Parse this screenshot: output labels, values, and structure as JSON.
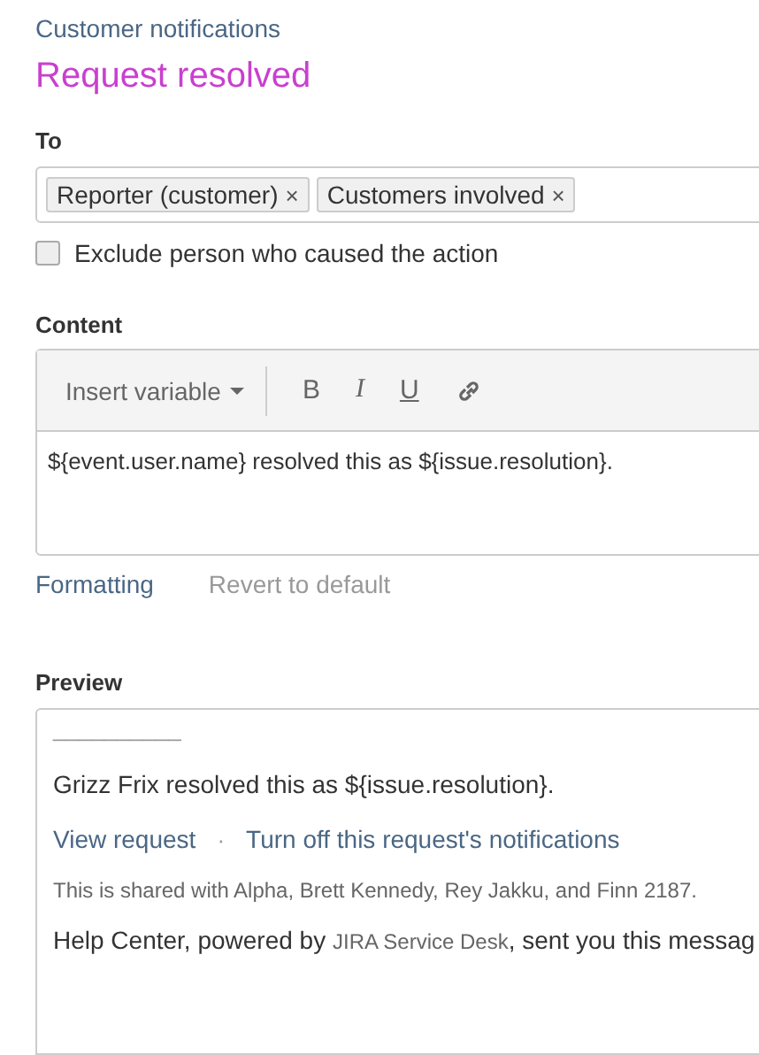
{
  "breadcrumb": "Customer notifications",
  "title": "Request resolved",
  "to": {
    "label": "To",
    "recipients": [
      {
        "label": "Reporter (customer)",
        "remove": "×"
      },
      {
        "label": "Customers involved",
        "remove": "×"
      }
    ]
  },
  "exclude": {
    "label": "Exclude person who caused the action",
    "checked": false
  },
  "content": {
    "label": "Content",
    "insert_variable": "Insert variable",
    "toolbar": [
      {
        "kind": "bold",
        "label": "B"
      },
      {
        "kind": "italic",
        "label": "I"
      },
      {
        "kind": "underline",
        "label": "U"
      },
      {
        "kind": "link"
      }
    ],
    "value": "${event.user.name} resolved this as ${issue.resolution}."
  },
  "links": [
    {
      "label": "Formatting",
      "disabled": false
    },
    {
      "label": "Revert to default",
      "disabled": true
    }
  ],
  "preview": {
    "label": "Preview",
    "rule": "__________",
    "body": "Grizz Frix resolved this as ${issue.resolution}.",
    "actions": [
      "View request",
      "Turn off this request's notifications"
    ],
    "separator": "·",
    "shared": "This is shared with Alpha, Brett Kennedy, Rey Jakku, and Finn 2187.",
    "footer": {
      "before": "Help Center, powered by ",
      "product": "JIRA Service Desk",
      "after": ", sent you this messag"
    }
  }
}
